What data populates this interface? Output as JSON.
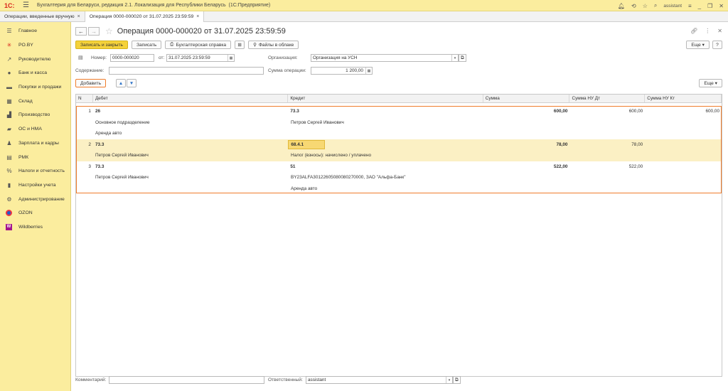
{
  "app": {
    "logo": "1С:",
    "title": "Бухгалтерия для Беларуси, редакция 2.1. Локализация для Республики Беларусь",
    "platform": "(1С:Предприятие)",
    "user": "assistant"
  },
  "tabs": [
    {
      "label": "Операции, введенные вручную"
    },
    {
      "label": "Операция 0000-000020 от 31.07.2025 23:59:59"
    }
  ],
  "sidebar": {
    "items": [
      {
        "label": "Главное",
        "icon": "menu-icon"
      },
      {
        "label": "PO.BY",
        "icon": "star-icon"
      },
      {
        "label": "Руководителю",
        "icon": "chart-icon"
      },
      {
        "label": "Банк и касса",
        "icon": "bank-icon"
      },
      {
        "label": "Покупки и продажи",
        "icon": "cart-icon"
      },
      {
        "label": "Склад",
        "icon": "warehouse-icon"
      },
      {
        "label": "Производство",
        "icon": "factory-icon"
      },
      {
        "label": "ОС и НМА",
        "icon": "truck-icon"
      },
      {
        "label": "Зарплата и кадры",
        "icon": "person-icon"
      },
      {
        "label": "РМК",
        "icon": "register-icon"
      },
      {
        "label": "Налоги и отчетность",
        "icon": "percent-icon"
      },
      {
        "label": "Настройки учета",
        "icon": "settings-book-icon"
      },
      {
        "label": "Администрирование",
        "icon": "gear-icon"
      },
      {
        "label": "OZON",
        "icon": "ozon-icon"
      },
      {
        "label": "Wildberries",
        "icon": "wb-icon"
      }
    ]
  },
  "doc": {
    "title": "Операция 0000-000020 от 31.07.2025 23:59:59",
    "toolbar": {
      "save_close": "Записать и закрыть",
      "save": "Записать",
      "help": "Бухгалтерская справка",
      "files": "Файлы в облаке",
      "more": "Еще"
    },
    "fields": {
      "number_label": "Номер:",
      "number": "0000-000020",
      "date_label": "от:",
      "date": "31.07.2025 23:59:59",
      "org_label": "Организация:",
      "org": "Организация на УСН",
      "content_label": "Содержание:",
      "content": "",
      "sum_label": "Сумма операции:",
      "sum": "1 200,00"
    },
    "table_toolbar": {
      "add": "Добавить",
      "more": "Еще"
    },
    "columns": [
      "N",
      "Дебет",
      "Кредит",
      "Сумма",
      "Сумма НУ Дт",
      "Сумма НУ Кт"
    ],
    "rows": [
      {
        "n": "1",
        "debit": "26",
        "credit": "73.3",
        "sum": "600,00",
        "nu_dt": "600,00",
        "nu_kt": "600,00",
        "debit_sub1": "Основное подразделение",
        "credit_sub1": "Петров Сергей Иванович",
        "debit_sub2": "Аренда авто",
        "credit_sub2": ""
      },
      {
        "n": "2",
        "debit": "73.3",
        "credit": "68.4.1",
        "sum": "78,00",
        "nu_dt": "78,00",
        "nu_kt": "",
        "debit_sub1": "Петров Сергей Иванович",
        "credit_sub1": "Налог (взносы): начислено / уплачено"
      },
      {
        "n": "3",
        "debit": "73.3",
        "credit": "51",
        "sum": "522,00",
        "nu_dt": "522,00",
        "nu_kt": "",
        "debit_sub1": "Петров Сергей Иванович",
        "credit_sub1": "BY23ALFA30122605080080270000, ЗАО \"Альфа-Банк\"",
        "debit_sub2": "",
        "credit_sub2": "Аренда авто"
      }
    ],
    "footer": {
      "comment_label": "Комментарий:",
      "comment": "",
      "resp_label": "Ответственный:",
      "resp": "assistant"
    }
  }
}
